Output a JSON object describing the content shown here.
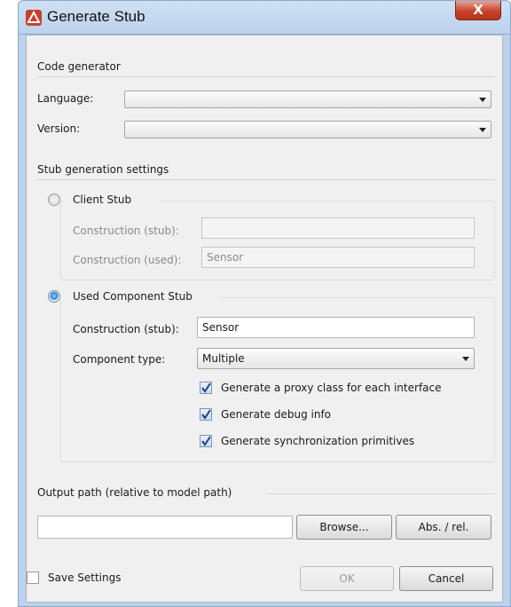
{
  "window": {
    "title": "Generate Stub",
    "close_glyph": "X",
    "icon": "app-logo-icon"
  },
  "code_generator": {
    "title": "Code generator",
    "language_label": "Language:",
    "language_value": "",
    "version_label": "Version:",
    "version_value": ""
  },
  "stub_settings": {
    "title": "Stub generation settings",
    "client_stub": {
      "label": "Client Stub",
      "selected": false,
      "construction_stub_label": "Construction (stub):",
      "construction_stub_value": "",
      "construction_used_label": "Construction (used):",
      "construction_used_value": "Sensor"
    },
    "used_component_stub": {
      "label": "Used Component Stub",
      "selected": true,
      "construction_stub_label": "Construction (stub):",
      "construction_stub_value": "Sensor",
      "component_type_label": "Component type:",
      "component_type_value": "Multiple",
      "checkboxes": [
        {
          "label": "Generate a proxy class for each interface",
          "checked": true
        },
        {
          "label": "Generate debug info",
          "checked": true
        },
        {
          "label": "Generate synchronization primitives",
          "checked": true
        }
      ]
    }
  },
  "output": {
    "title": "Output path (relative to model path)",
    "path_value": "",
    "browse_label": "Browse...",
    "absrel_label": "Abs. / rel."
  },
  "footer": {
    "save_settings_label": "Save Settings",
    "save_settings_checked": false,
    "ok_label": "OK",
    "cancel_label": "Cancel"
  },
  "colors": {
    "titlebar": "#bcd2ec",
    "close_button": "#c7432b",
    "dialog_bg": "#f0f0f0",
    "checkbox_check": "#1f3f8a"
  }
}
